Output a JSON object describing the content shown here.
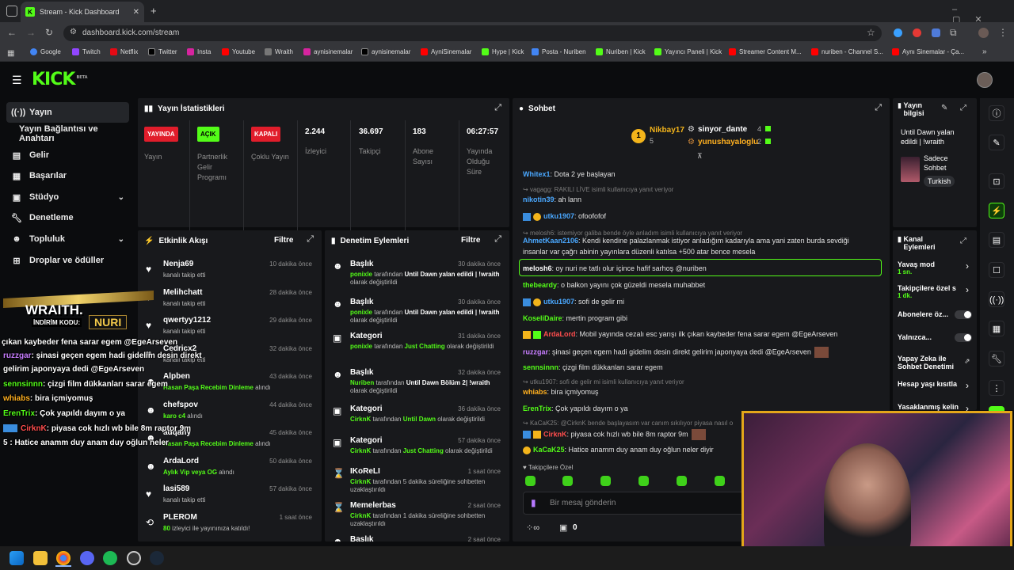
{
  "browser": {
    "tab_title": "Stream - Kick Dashboard",
    "url": "dashboard.kick.com/stream",
    "new_tab": "+",
    "bookmarks": [
      "Google",
      "Twitch",
      "Netflix",
      "Twitter",
      "Insta",
      "Youtube",
      "Wraith",
      "aynisinemalar",
      "aynisinemalar",
      "AyniSinemalar",
      "Hype | Kick",
      "Posta - Nuriben",
      "Nuriben | Kick",
      "Yayıncı Paneli | Kick",
      "Streamer Content M...",
      "nuriben - Channel S...",
      "Aynı Sinemalar - Ça..."
    ]
  },
  "brand": {
    "logo": "KICK",
    "beta": "BETA"
  },
  "sidebar": [
    {
      "label": "Yayın",
      "icon": "broadcast-icon"
    },
    {
      "label": "Yayın Bağlantısı ve Anahtarı"
    },
    {
      "label": "Gelir",
      "icon": "income-icon"
    },
    {
      "label": "Başarılar",
      "icon": "achievements-icon"
    },
    {
      "label": "Stüdyo",
      "icon": "studio-icon"
    },
    {
      "label": "Denetleme",
      "icon": "wrench-icon"
    },
    {
      "label": "Topluluk",
      "icon": "community-icon"
    },
    {
      "label": "Droplar ve ödüller",
      "icon": "gift-icon"
    }
  ],
  "stats": {
    "title": "Yayın İstatistikleri",
    "live": {
      "badge": "YAYINDA",
      "label": "Yayın"
    },
    "partner": {
      "badge": "AÇIK",
      "label": "Partnerlik Gelir Programı"
    },
    "multi": {
      "badge": "KAPALI",
      "label": "Çoklu Yayın"
    },
    "viewers": {
      "value": "2.244",
      "label": "İzleyici"
    },
    "followers": {
      "value": "36.697",
      "label": "Takipçi"
    },
    "subs": {
      "value": "183",
      "label": "Abone Sayısı"
    },
    "time": {
      "value": "06:27:57",
      "label": "Yayında Olduğu Süre"
    }
  },
  "activity": {
    "title": "Etkinlik Akışı",
    "filter": "Filtre",
    "items": [
      {
        "name": "Nenja69",
        "sub": "kanalı takip etti",
        "time": "10 dakika önce"
      },
      {
        "name": "Melihchatt",
        "sub": "kanalı takip etti",
        "time": "28 dakika önce"
      },
      {
        "name": "qwertyy1212",
        "sub": "kanalı takip etti",
        "time": "29 dakika önce"
      },
      {
        "name": "Cedricx2",
        "sub": "kanalı takip etti",
        "time": "32 dakika önce"
      },
      {
        "name": "Alpben",
        "sub": "Hasan Paşa Recebim Dinleme",
        "sub2": " alındı",
        "time": "43 dakika önce"
      },
      {
        "name": "chefspov",
        "sub": "karo c4",
        "sub2": " alındı",
        "time": "44 dakika önce"
      },
      {
        "name": "adqany",
        "sub": "Hasan Paşa Recebim Dinleme",
        "sub2": " alındı",
        "time": "45 dakika önce"
      },
      {
        "name": "ArdaLord",
        "sub": "Aylık Vip veya OG",
        "sub2": " alındı",
        "time": "50 dakika önce"
      },
      {
        "name": "lasi589",
        "sub": "kanalı takip etti",
        "time": "57 dakika önce"
      },
      {
        "name": "PLEROM",
        "sub": "80",
        "sub2": " izleyici ile yayınınıza katıldı!",
        "time": "1 saat önce"
      }
    ]
  },
  "mod": {
    "title": "Denetim Eylemleri",
    "filter": "Filtre",
    "items": [
      {
        "title": "Başlık",
        "user": "ponixle",
        "mid": " tarafından ",
        "val": "Until Dawn yalan edildi | !wraith",
        "end": " olarak değiştirildi",
        "time": "30 dakika önce"
      },
      {
        "title": "Başlık",
        "user": "ponixle",
        "mid": " tarafından ",
        "val": "Until Dawn yalan edildi | !wraith",
        "end": " olarak değiştirildi",
        "time": "30 dakika önce"
      },
      {
        "title": "Kategori",
        "user": "ponixle",
        "mid": " tarafından ",
        "val": "Just Chatting",
        "end": " olarak değiştirildi",
        "time": "31 dakika önce"
      },
      {
        "title": "Başlık",
        "user": "Nuriben",
        "mid": " tarafından ",
        "val": "Until Dawn Bölüm 2| !wraith",
        "end": " olarak değiştirildi",
        "time": "32 dakika önce"
      },
      {
        "title": "Kategori",
        "user": "CirknK",
        "mid": " tarafından ",
        "val": "Until Dawn",
        "end": " olarak değiştirildi",
        "time": "36 dakika önce"
      },
      {
        "title": "Kategori",
        "user": "CirknK",
        "mid": " tarafından ",
        "val": "Just Chatting",
        "end": " olarak değiştirildi",
        "time": "57 dakika önce"
      },
      {
        "title": "IKoReLI",
        "user": "CirknK",
        "mid": " tarafından 5 dakika süreliğine sohbetten uzaklaştırıldı",
        "val": "",
        "end": "",
        "time": "1 saat önce"
      },
      {
        "title": "Memelerbas",
        "user": "CirknK",
        "mid": " tarafından 1 dakika süreliğine sohbetten uzaklaştırıldı",
        "val": "",
        "end": "",
        "time": "2 saat önce"
      },
      {
        "title": "Başlık",
        "user": "",
        "mid": "",
        "val": "",
        "end": "",
        "time": "2 saat önce"
      }
    ]
  },
  "chat": {
    "title": "Sohbet",
    "top": [
      {
        "name": "Nikbay17",
        "count": "5"
      },
      {
        "name": "sinyor_dante",
        "count": "4"
      },
      {
        "name": "yunushayaloglu",
        "count": "2"
      }
    ],
    "lines": [
      {
        "u": "Whitex1",
        "c": "#4aa8ff",
        "m": ": Dota 2 ye başlayan"
      },
      {
        "reply": "vagagg: RAKILI LİVE isimli kullanıcıya yanıt veriyor"
      },
      {
        "u": "nikotin39",
        "c": "#4aa8ff",
        "m": ": ah lann"
      },
      {
        "u": "utku1907",
        "c": "#4aa8ff",
        "m": ": ofoofofof"
      },
      {
        "reply": "melosh6: istemiyor galiba bende öyle anladım isimli kullanıcıya yanıt veriyor"
      },
      {
        "u": "AhmetKaan2106",
        "c": "#4aa8ff",
        "m": ": Kendi kendine palazlanmak istiyor anladığım kadarıyla ama yani zaten burda sevdiği"
      },
      {
        "u": "",
        "c": "",
        "m": "insanlar var çağrı abinin yayınlara düzenli katılsa +500 atar bence mesela"
      },
      {
        "u": "melosh6",
        "c": "#ffffff",
        "m": ": oy nuri ne tatlı olur içince hafif sarhoş @nuriben"
      },
      {
        "u": "thebeardy",
        "c": "#53fc18",
        "m": ": o balkon yayını çok güzeldi mesela muhabbet"
      },
      {
        "u": "utku1907",
        "c": "#4aa8ff",
        "m": ": sofi de gelir mi"
      },
      {
        "u": "KoseliDaire",
        "c": "#53fc18",
        "m": ": mertin program gibi"
      },
      {
        "u": "ArdaLord",
        "c": "#ff4d4d",
        "m": ": Mobil yayında cezalı esc yarışı ilk çıkan kaybeder fena sarar egem @EgeArseven"
      },
      {
        "u": "ruzzgar",
        "c": "#c77dff",
        "m": ": şinasi geçen egem hadi gidelim desin direkt gelirim japonyaya dedi @EgeArseven"
      },
      {
        "u": "sennsinnn",
        "c": "#53fc18",
        "m": ": çizgi film dükkanları sarar egem"
      },
      {
        "reply": "utku1907: sofi de gelir mi isimli kullanıcıya yanıt veriyor"
      },
      {
        "u": "whiabs",
        "c": "#ffb020",
        "m": ": bira içmiyomuş"
      },
      {
        "u": "ErenTrix",
        "c": "#53fc18",
        "m": ": Çok yapıldı dayım o ya"
      },
      {
        "reply": "KaCaK25: @CirknK bende başlayasım var canım sıkılıyor piyasa nasıl o"
      },
      {
        "u": "CirknK",
        "c": "#ff4d4d",
        "m": ": piyasa cok hızlı wb bile 8m raptor 9m"
      },
      {
        "u": "KaCaK25",
        "c": "#53fc18",
        "m": ": Hatice anamm duy anam duy oğlun neler diyir"
      }
    ],
    "followers_only": "Takipçilere Özel",
    "input_placeholder": "Bir mesaj gönderin",
    "points": "0"
  },
  "info": {
    "title": "Yayın bilgisi",
    "stream_title": "Until Dawn yalan edildi | !wraith",
    "category": "Sadece Sohbet",
    "language": "Turkish"
  },
  "channel": {
    "title": "Kanal Eylemleri",
    "items": [
      {
        "label": "Yavaş mod",
        "sub": "1 sn."
      },
      {
        "label": "Takipçilere özel s",
        "sub": "1 dk."
      },
      {
        "label": "Abonelere öz...",
        "sub": ""
      },
      {
        "label": "Yalnızca...",
        "sub": ""
      },
      {
        "label": "Yapay Zeka ile Sohbet Denetimi",
        "sub": ""
      },
      {
        "label": "Hesap yaşı kısıtla",
        "sub": ""
      },
      {
        "label": "Yasaklanmış kelin",
        "sub": ""
      }
    ]
  },
  "overlay": {
    "brand": "WRAITH.",
    "code_label": "İNDİRİM KODU:",
    "code": "NURI",
    "lines": [
      {
        "u": "",
        "m": "çıkan kaybeder fena sarar egem @EgeArseven"
      },
      {
        "u": "ruzzgar",
        "m": ": şinasi geçen egem hadi gidelim desin direkt"
      },
      {
        "u": "",
        "m": "gelirim japonyaya dedi @EgeArseven"
      },
      {
        "u": "sennsinnn",
        "m": ": çizgi film dükkanları sarar egem"
      },
      {
        "u": "whiabs",
        "m": ": bira içmiyomuş"
      },
      {
        "u": "ErenTrix",
        "m": ": Çok yapıldı dayım o ya"
      },
      {
        "u": "CirknK",
        "m": ": piyasa cok hızlı wb bile 8m raptor 9m"
      },
      {
        "u": "",
        "m": "5 : Hatice anamm duy anam duy oğlun neler"
      }
    ]
  },
  "colors": {
    "kick_green": "#53fc18",
    "live_red": "#e11d2b",
    "panel": "#18191c"
  }
}
